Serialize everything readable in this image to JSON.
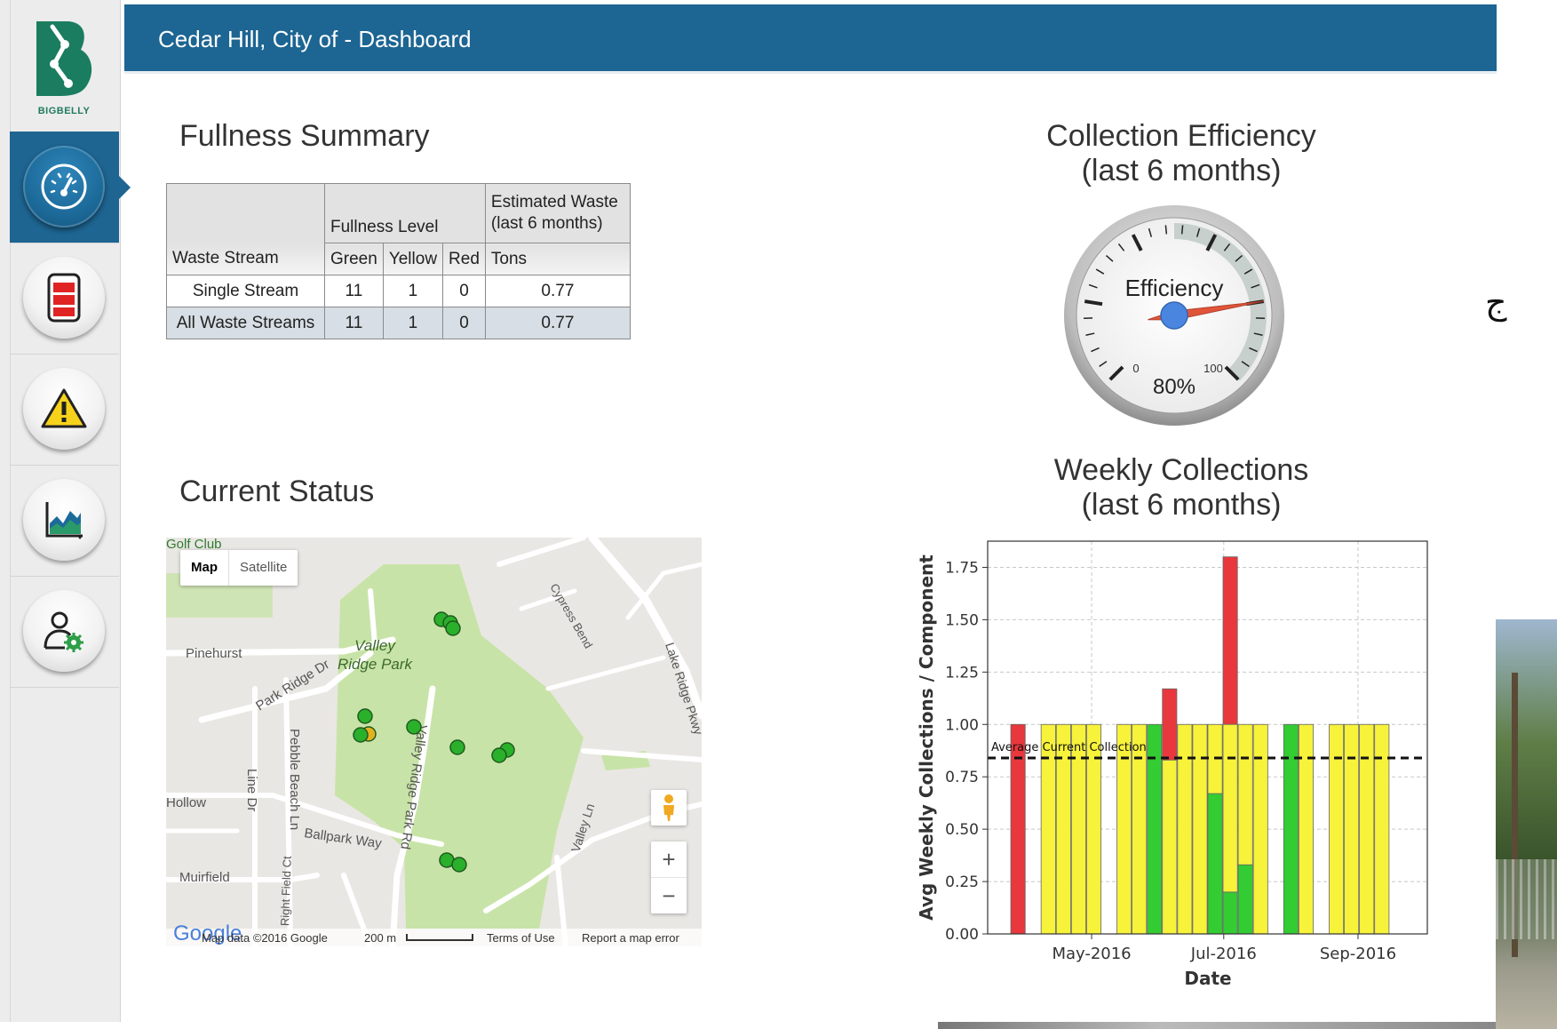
{
  "sidebar": {
    "logo_text": "BIGBELLY",
    "items": [
      {
        "icon": "dashboard-gauge-icon",
        "active": true
      },
      {
        "icon": "fullness-bin-icon",
        "active": false
      },
      {
        "icon": "warning-icon",
        "active": false
      },
      {
        "icon": "reports-chart-icon",
        "active": false
      },
      {
        "icon": "user-settings-icon",
        "active": false
      }
    ]
  },
  "header": {
    "title": "Cedar Hill, City of - Dashboard",
    "color": "#1d6592"
  },
  "fullness_summary": {
    "title": "Fullness Summary",
    "headers": {
      "fullness_level": "Fullness Level",
      "estimated_waste": "Estimated Waste (last 6 months)",
      "waste_stream": "Waste Stream",
      "green": "Green",
      "yellow": "Yellow",
      "red": "Red",
      "tons": "Tons"
    },
    "rows": [
      {
        "stream": "Single Stream",
        "green": "11",
        "yellow": "1",
        "red": "0",
        "tons": "0.77"
      },
      {
        "stream": "All Waste Streams",
        "green": "11",
        "yellow": "1",
        "red": "0",
        "tons": "0.77"
      }
    ]
  },
  "collection_efficiency": {
    "title_line1": "Collection Efficiency",
    "title_line2": "(last 6 months)",
    "gauge_label": "Efficiency",
    "value_text": "80%",
    "value": 80,
    "min_label": "0",
    "max_label": "100"
  },
  "current_status": {
    "title": "Current Status",
    "map": {
      "type_map": "Map",
      "type_satellite": "Satellite",
      "labels": {
        "golf": "Golf Club",
        "pinehurst": "Pinehurst",
        "park_ridge": "Park Ridge Dr",
        "valley_ridge_park_1": "Valley",
        "valley_ridge_park_2": "Ridge Park",
        "cypress": "Cypress Bend",
        "lake_ridge": "Lake Ridge Pkwy",
        "pebble": "Pebble Beach Ln",
        "line_dr": "Line Dr",
        "hollow": "Hollow",
        "ballpark": "Ballpark Way",
        "valley_ridge_rd": "Valley Ridge Park Rd",
        "muirfield": "Muirfield",
        "right_field": "Right Field Ct",
        "valley_ln": "Valley Ln"
      },
      "footer": {
        "google": "Google",
        "map_data": "Map data ©2016 Google",
        "scale": "200 m",
        "terms": "Terms of Use",
        "report": "Report a map error"
      },
      "zoom_in": "+",
      "zoom_out": "−"
    }
  },
  "weekly_collections": {
    "title_line1": "Weekly Collections",
    "title_line2": "(last 6 months)"
  },
  "chart_data": {
    "type": "bar",
    "title": "Weekly Collections (last 6 months)",
    "xlabel": "Date",
    "ylabel": "Avg Weekly Collections / Component",
    "ylim": [
      0,
      1.875
    ],
    "yticks": [
      "0.00",
      "0.25",
      "0.50",
      "0.75",
      "1.00",
      "1.25",
      "1.50",
      "1.75"
    ],
    "xticks": [
      "May-2016",
      "Jul-2016",
      "Sep-2016"
    ],
    "grid": true,
    "reference_line": {
      "label": "Average Current Collection",
      "value": 0.84
    },
    "colors": {
      "red": "#e8383d",
      "yellow": "#f7f23a",
      "green": "#33cc33"
    },
    "bars": [
      {
        "week": "2016-03-28",
        "color": "red",
        "value": 1.0
      },
      {
        "week": "2016-04-11",
        "color": "yellow",
        "value": 1.0
      },
      {
        "week": "2016-04-18",
        "color": "yellow",
        "value": 1.0
      },
      {
        "week": "2016-04-25",
        "color": "yellow",
        "value": 1.0
      },
      {
        "week": "2016-05-02",
        "color": "yellow",
        "value": 1.0
      },
      {
        "week": "2016-05-16",
        "color": "yellow",
        "value": 1.0
      },
      {
        "week": "2016-05-23",
        "color": "yellow",
        "value": 1.0
      },
      {
        "week": "2016-05-30",
        "color": "green",
        "value": 1.0
      },
      {
        "week": "2016-06-06",
        "color": "red",
        "value": 1.17,
        "base": 0.83
      },
      {
        "week": "2016-06-06",
        "color": "yellow",
        "value": 0.83
      },
      {
        "week": "2016-06-13",
        "color": "yellow",
        "value": 1.0
      },
      {
        "week": "2016-06-20",
        "color": "yellow",
        "value": 1.0
      },
      {
        "week": "2016-06-27",
        "color": "green",
        "value": 0.67
      },
      {
        "week": "2016-06-27",
        "color": "yellow",
        "value": 1.0,
        "base": 0.67
      },
      {
        "week": "2016-07-04",
        "color": "red",
        "value": 1.8,
        "base": 1.0
      },
      {
        "week": "2016-07-04",
        "color": "green",
        "value": 0.2
      },
      {
        "week": "2016-07-04",
        "color": "yellow",
        "value": 1.0,
        "base": 0.2
      },
      {
        "week": "2016-07-11",
        "color": "green",
        "value": 0.33
      },
      {
        "week": "2016-07-11",
        "color": "yellow",
        "value": 1.0,
        "base": 0.33
      },
      {
        "week": "2016-07-18",
        "color": "yellow",
        "value": 1.0
      },
      {
        "week": "2016-08-01",
        "color": "green",
        "value": 1.0
      },
      {
        "week": "2016-08-08",
        "color": "yellow",
        "value": 1.0
      },
      {
        "week": "2016-08-22",
        "color": "yellow",
        "value": 1.0
      },
      {
        "week": "2016-08-29",
        "color": "yellow",
        "value": 1.0
      },
      {
        "week": "2016-09-05",
        "color": "yellow",
        "value": 1.0
      },
      {
        "week": "2016-09-12",
        "color": "yellow",
        "value": 1.0
      }
    ]
  }
}
